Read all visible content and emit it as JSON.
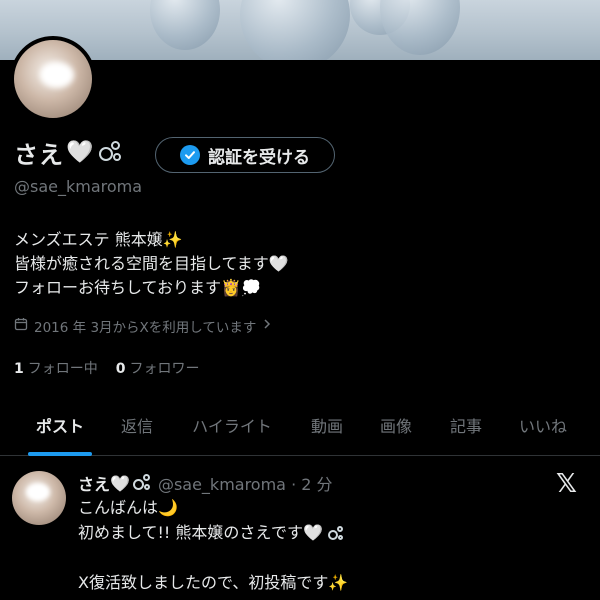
{
  "profile": {
    "display_name": "さえ",
    "heart_emoji": "🤍",
    "handle": "@sae_kmaroma",
    "verify_button_label": "認証を受ける",
    "bio_lines": [
      "メンズエステ 熊本嬢",
      "皆様が癒される空間を目指してます",
      "フォローお待ちしております"
    ],
    "joined_text": "2016 年 3月からXを利用しています",
    "following_count": "1",
    "following_label": "フォロー中",
    "followers_count": "0",
    "followers_label": "フォロワー"
  },
  "tabs": [
    {
      "label": "ポスト",
      "active": true
    },
    {
      "label": "返信",
      "active": false
    },
    {
      "label": "ハイライト",
      "active": false
    },
    {
      "label": "動画",
      "active": false
    },
    {
      "label": "画像",
      "active": false
    },
    {
      "label": "記事",
      "active": false
    },
    {
      "label": "いいね",
      "active": false
    }
  ],
  "post": {
    "author_name": "さえ",
    "handle_time": "@sae_kmaroma · 2 分",
    "lines": [
      "こんばんは",
      "初めまして!! 熊本嬢のさえです",
      "",
      "X復活致しましたので、初投稿です"
    ],
    "x_logo": "𝕏"
  },
  "colors": {
    "accent": "#1d9bf0",
    "text_primary": "#e7e9ea",
    "text_secondary": "#71767b",
    "background": "#000000"
  },
  "icons": [
    "bubbles-icon",
    "verified-check-icon",
    "calendar-icon",
    "chevron-right-icon",
    "sparkles-icon",
    "moon-icon",
    "x-logo-icon"
  ]
}
